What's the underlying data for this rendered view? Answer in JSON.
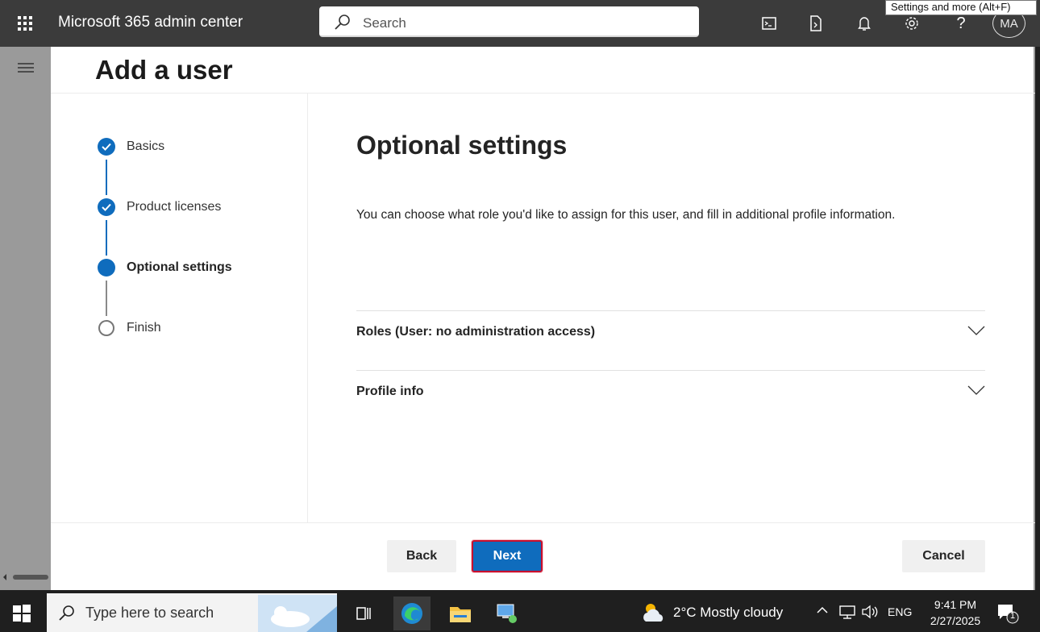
{
  "topbar": {
    "app_title": "Microsoft 365 admin center",
    "search_placeholder": "Search",
    "avatar_initials": "MA",
    "tooltip": "Settings and more (Alt+F)"
  },
  "page": {
    "title": "Add a user"
  },
  "stepper": {
    "steps": [
      {
        "label": "Basics",
        "state": "done"
      },
      {
        "label": "Product licenses",
        "state": "done"
      },
      {
        "label": "Optional settings",
        "state": "current"
      },
      {
        "label": "Finish",
        "state": "todo"
      }
    ]
  },
  "content": {
    "title": "Optional settings",
    "description": "You can choose what role you'd like to assign for this user, and fill in additional profile information.",
    "accordions": [
      {
        "label": "Roles (User: no administration access)"
      },
      {
        "label": "Profile info"
      }
    ]
  },
  "footer": {
    "back_label": "Back",
    "next_label": "Next",
    "cancel_label": "Cancel"
  },
  "taskbar": {
    "search_placeholder": "Type here to search",
    "weather": "2°C  Mostly cloudy",
    "language": "ENG",
    "time": "9:41 PM",
    "date": "2/27/2025",
    "notification_count": "1"
  },
  "colors": {
    "accent": "#0f6cbd",
    "topbar": "#3b3b3b",
    "highlight_border": "#c8102e"
  }
}
